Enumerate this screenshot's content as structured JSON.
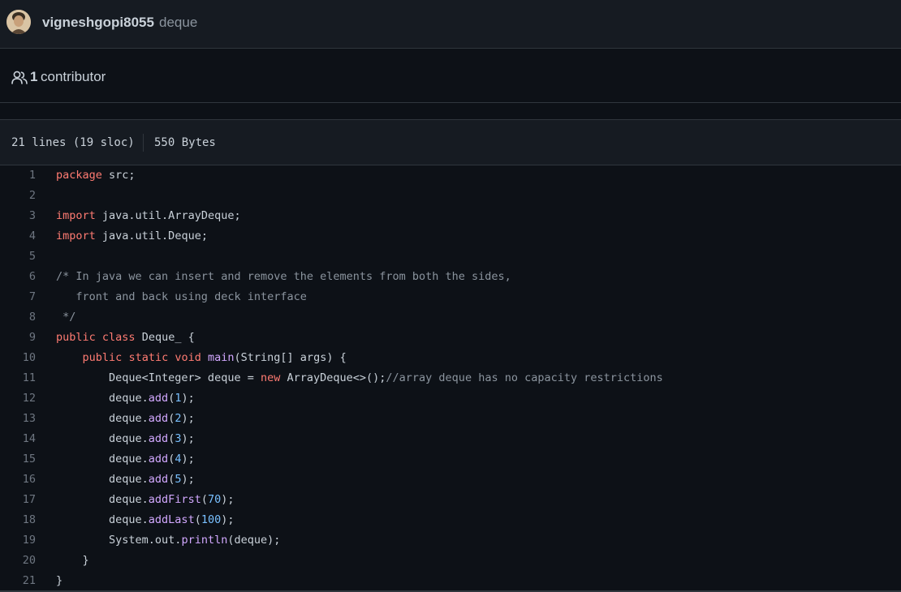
{
  "commit": {
    "author": "vigneshgopi8055",
    "message": "deque"
  },
  "contributors": {
    "count": "1",
    "label": "contributor"
  },
  "file": {
    "lines": "21 lines (19 sloc)",
    "size": "550 Bytes"
  },
  "code_lines": [
    {
      "n": "1",
      "tokens": [
        {
          "t": "package",
          "c": "kw"
        },
        {
          "t": " src;",
          "c": ""
        }
      ]
    },
    {
      "n": "2",
      "tokens": []
    },
    {
      "n": "3",
      "tokens": [
        {
          "t": "import",
          "c": "kw"
        },
        {
          "t": " java.util.ArrayDeque;",
          "c": ""
        }
      ]
    },
    {
      "n": "4",
      "tokens": [
        {
          "t": "import",
          "c": "kw"
        },
        {
          "t": " java.util.Deque;",
          "c": ""
        }
      ]
    },
    {
      "n": "5",
      "tokens": []
    },
    {
      "n": "6",
      "tokens": [
        {
          "t": "/* In java we can insert and remove the elements from both the sides,",
          "c": "cm"
        }
      ]
    },
    {
      "n": "7",
      "tokens": [
        {
          "t": "   front and back using deck interface",
          "c": "cm"
        }
      ]
    },
    {
      "n": "8",
      "tokens": [
        {
          "t": " */",
          "c": "cm"
        }
      ]
    },
    {
      "n": "9",
      "tokens": [
        {
          "t": "public",
          "c": "kw"
        },
        {
          "t": " ",
          "c": ""
        },
        {
          "t": "class",
          "c": "kw"
        },
        {
          "t": " Deque_ {",
          "c": ""
        }
      ]
    },
    {
      "n": "10",
      "tokens": [
        {
          "t": "    ",
          "c": ""
        },
        {
          "t": "public",
          "c": "kw"
        },
        {
          "t": " ",
          "c": ""
        },
        {
          "t": "static",
          "c": "kw"
        },
        {
          "t": " ",
          "c": ""
        },
        {
          "t": "void",
          "c": "kw"
        },
        {
          "t": " ",
          "c": ""
        },
        {
          "t": "main",
          "c": "fn"
        },
        {
          "t": "(String[] args) {",
          "c": ""
        }
      ]
    },
    {
      "n": "11",
      "tokens": [
        {
          "t": "        Deque<Integer> deque = ",
          "c": ""
        },
        {
          "t": "new",
          "c": "kw"
        },
        {
          "t": " ArrayDeque<>();",
          "c": ""
        },
        {
          "t": "//array deque has no capacity restrictions",
          "c": "cm"
        }
      ]
    },
    {
      "n": "12",
      "tokens": [
        {
          "t": "        deque.",
          "c": ""
        },
        {
          "t": "add",
          "c": "fn"
        },
        {
          "t": "(",
          "c": ""
        },
        {
          "t": "1",
          "c": "nm"
        },
        {
          "t": ");",
          "c": ""
        }
      ]
    },
    {
      "n": "13",
      "tokens": [
        {
          "t": "        deque.",
          "c": ""
        },
        {
          "t": "add",
          "c": "fn"
        },
        {
          "t": "(",
          "c": ""
        },
        {
          "t": "2",
          "c": "nm"
        },
        {
          "t": ");",
          "c": ""
        }
      ]
    },
    {
      "n": "14",
      "tokens": [
        {
          "t": "        deque.",
          "c": ""
        },
        {
          "t": "add",
          "c": "fn"
        },
        {
          "t": "(",
          "c": ""
        },
        {
          "t": "3",
          "c": "nm"
        },
        {
          "t": ");",
          "c": ""
        }
      ]
    },
    {
      "n": "15",
      "tokens": [
        {
          "t": "        deque.",
          "c": ""
        },
        {
          "t": "add",
          "c": "fn"
        },
        {
          "t": "(",
          "c": ""
        },
        {
          "t": "4",
          "c": "nm"
        },
        {
          "t": ");",
          "c": ""
        }
      ]
    },
    {
      "n": "16",
      "tokens": [
        {
          "t": "        deque.",
          "c": ""
        },
        {
          "t": "add",
          "c": "fn"
        },
        {
          "t": "(",
          "c": ""
        },
        {
          "t": "5",
          "c": "nm"
        },
        {
          "t": ");",
          "c": ""
        }
      ]
    },
    {
      "n": "17",
      "tokens": [
        {
          "t": "        deque.",
          "c": ""
        },
        {
          "t": "addFirst",
          "c": "fn"
        },
        {
          "t": "(",
          "c": ""
        },
        {
          "t": "70",
          "c": "nm"
        },
        {
          "t": ");",
          "c": ""
        }
      ]
    },
    {
      "n": "18",
      "tokens": [
        {
          "t": "        deque.",
          "c": ""
        },
        {
          "t": "addLast",
          "c": "fn"
        },
        {
          "t": "(",
          "c": ""
        },
        {
          "t": "100",
          "c": "nm"
        },
        {
          "t": ");",
          "c": ""
        }
      ]
    },
    {
      "n": "19",
      "tokens": [
        {
          "t": "        System.out.",
          "c": ""
        },
        {
          "t": "println",
          "c": "fn"
        },
        {
          "t": "(deque);",
          "c": ""
        }
      ]
    },
    {
      "n": "20",
      "tokens": [
        {
          "t": "    }",
          "c": ""
        }
      ]
    },
    {
      "n": "21",
      "tokens": [
        {
          "t": "}",
          "c": ""
        }
      ]
    }
  ],
  "icons": {
    "avatar": "avatar",
    "contributors": "people-icon"
  },
  "colors": {
    "background": "#0d1117",
    "keyword": "#ff7b72",
    "comment": "#8b949e",
    "function": "#d2a8ff",
    "number": "#79c0ff"
  }
}
